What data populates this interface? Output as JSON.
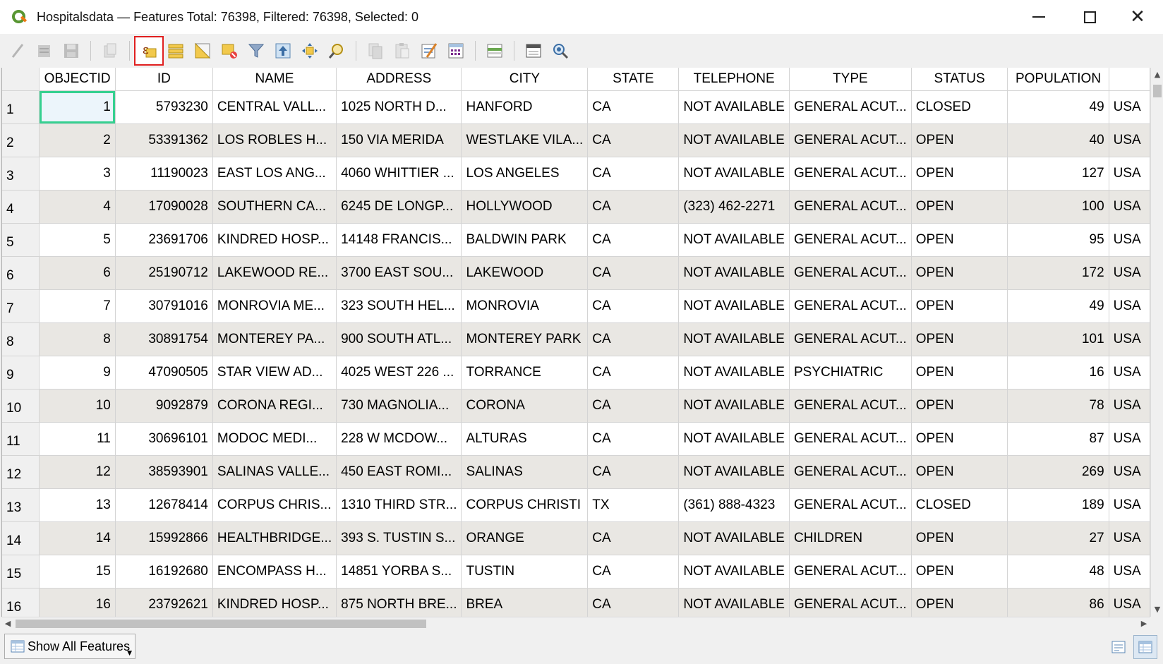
{
  "window": {
    "title": "Hospitalsdata — Features Total: 76398, Filtered: 76398, Selected: 0"
  },
  "toolbar": [
    {
      "name": "toggle-editing-icon",
      "tip": "Toggle editing mode"
    },
    {
      "name": "toggle-multi-edit-icon",
      "tip": "Toggle multi edit mode"
    },
    {
      "name": "save-edits-icon",
      "tip": "Save edits"
    },
    {
      "name": "delete-features-icon",
      "tip": "Delete selected features"
    },
    {
      "name": "select-by-expression-icon",
      "tip": "Select features using an expression",
      "highlighted": true
    },
    {
      "name": "select-all-icon",
      "tip": "Select all"
    },
    {
      "name": "invert-selection-icon",
      "tip": "Invert selection"
    },
    {
      "name": "deselect-all-icon",
      "tip": "Deselect all"
    },
    {
      "name": "filter-select-icon",
      "tip": "Filter/Select features using form"
    },
    {
      "name": "move-selection-top-icon",
      "tip": "Move selection to top"
    },
    {
      "name": "pan-to-selection-icon",
      "tip": "Pan map to selected rows"
    },
    {
      "name": "zoom-to-selection-icon",
      "tip": "Zoom map to selected rows"
    },
    {
      "name": "copy-rows-icon",
      "tip": "Copy selected rows"
    },
    {
      "name": "paste-features-icon",
      "tip": "Paste features"
    },
    {
      "name": "new-field-icon",
      "tip": "New field"
    },
    {
      "name": "field-calculator-icon",
      "tip": "Open field calculator"
    },
    {
      "name": "conditional-formatting-icon",
      "tip": "Conditional formatting"
    },
    {
      "name": "dock-table-icon",
      "tip": "Dock attribute table"
    },
    {
      "name": "actions-icon",
      "tip": "Actions"
    }
  ],
  "table": {
    "columns": [
      "OBJECTID",
      "ID",
      "NAME",
      "ADDRESS",
      "CITY",
      "STATE",
      "TELEPHONE",
      "TYPE",
      "STATUS",
      "POPULATION",
      ""
    ],
    "rows": [
      [
        "1",
        "1",
        "5793230",
        "CENTRAL VALL...",
        "1025 NORTH D...",
        "HANFORD",
        "CA",
        "NOT AVAILABLE",
        "GENERAL ACUT...",
        "CLOSED",
        "49",
        "USA"
      ],
      [
        "2",
        "2",
        "53391362",
        "LOS ROBLES H...",
        "150 VIA MERIDA",
        "WESTLAKE VILA...",
        "CA",
        "NOT AVAILABLE",
        "GENERAL ACUT...",
        "OPEN",
        "40",
        "USA"
      ],
      [
        "3",
        "3",
        "11190023",
        "EAST LOS ANG...",
        "4060 WHITTIER ...",
        "LOS ANGELES",
        "CA",
        "NOT AVAILABLE",
        "GENERAL ACUT...",
        "OPEN",
        "127",
        "USA"
      ],
      [
        "4",
        "4",
        "17090028",
        "SOUTHERN CA...",
        "6245 DE LONGP...",
        "HOLLYWOOD",
        "CA",
        "(323) 462-2271",
        "GENERAL ACUT...",
        "OPEN",
        "100",
        "USA"
      ],
      [
        "5",
        "5",
        "23691706",
        "KINDRED HOSP...",
        "14148 FRANCIS...",
        "BALDWIN PARK",
        "CA",
        "NOT AVAILABLE",
        "GENERAL ACUT...",
        "OPEN",
        "95",
        "USA"
      ],
      [
        "6",
        "6",
        "25190712",
        "LAKEWOOD RE...",
        "3700 EAST SOU...",
        "LAKEWOOD",
        "CA",
        "NOT AVAILABLE",
        "GENERAL ACUT...",
        "OPEN",
        "172",
        "USA"
      ],
      [
        "7",
        "7",
        "30791016",
        "MONROVIA ME...",
        "323 SOUTH HEL...",
        "MONROVIA",
        "CA",
        "NOT AVAILABLE",
        "GENERAL ACUT...",
        "OPEN",
        "49",
        "USA"
      ],
      [
        "8",
        "8",
        "30891754",
        "MONTEREY PA...",
        "900 SOUTH ATL...",
        "MONTEREY PARK",
        "CA",
        "NOT AVAILABLE",
        "GENERAL ACUT...",
        "OPEN",
        "101",
        "USA"
      ],
      [
        "9",
        "9",
        "47090505",
        "STAR VIEW AD...",
        "4025 WEST 226 ...",
        "TORRANCE",
        "CA",
        "NOT AVAILABLE",
        "PSYCHIATRIC",
        "OPEN",
        "16",
        "USA"
      ],
      [
        "10",
        "10",
        "9092879",
        "CORONA REGI...",
        "730 MAGNOLIA...",
        "CORONA",
        "CA",
        "NOT AVAILABLE",
        "GENERAL ACUT...",
        "OPEN",
        "78",
        "USA"
      ],
      [
        "11",
        "11",
        "30696101",
        "MODOC MEDI...",
        "228 W MCDOW...",
        "ALTURAS",
        "CA",
        "NOT AVAILABLE",
        "GENERAL ACUT...",
        "OPEN",
        "87",
        "USA"
      ],
      [
        "12",
        "12",
        "38593901",
        "SALINAS VALLE...",
        "450 EAST ROMI...",
        "SALINAS",
        "CA",
        "NOT AVAILABLE",
        "GENERAL ACUT...",
        "OPEN",
        "269",
        "USA"
      ],
      [
        "13",
        "13",
        "12678414",
        "CORPUS CHRIS...",
        "1310 THIRD STR...",
        "CORPUS CHRISTI",
        "TX",
        "(361) 888-4323",
        "GENERAL ACUT...",
        "CLOSED",
        "189",
        "USA"
      ],
      [
        "14",
        "14",
        "15992866",
        "HEALTHBRIDGE...",
        "393 S. TUSTIN S...",
        "ORANGE",
        "CA",
        "NOT AVAILABLE",
        "CHILDREN",
        "OPEN",
        "27",
        "USA"
      ],
      [
        "15",
        "15",
        "16192680",
        "ENCOMPASS H...",
        "14851 YORBA S...",
        "TUSTIN",
        "CA",
        "NOT AVAILABLE",
        "GENERAL ACUT...",
        "OPEN",
        "48",
        "USA"
      ],
      [
        "16",
        "16",
        "23792621",
        "KINDRED HOSP...",
        "875 NORTH BRE...",
        "BREA",
        "CA",
        "NOT AVAILABLE",
        "GENERAL ACUT...",
        "OPEN",
        "86",
        "USA"
      ]
    ]
  },
  "footer": {
    "show_all_label": "Show All Features"
  },
  "colors": {
    "selected_cell_border": "#36d090",
    "alt_row": "#e9e7e3",
    "highlight_outline": "#e02020"
  }
}
